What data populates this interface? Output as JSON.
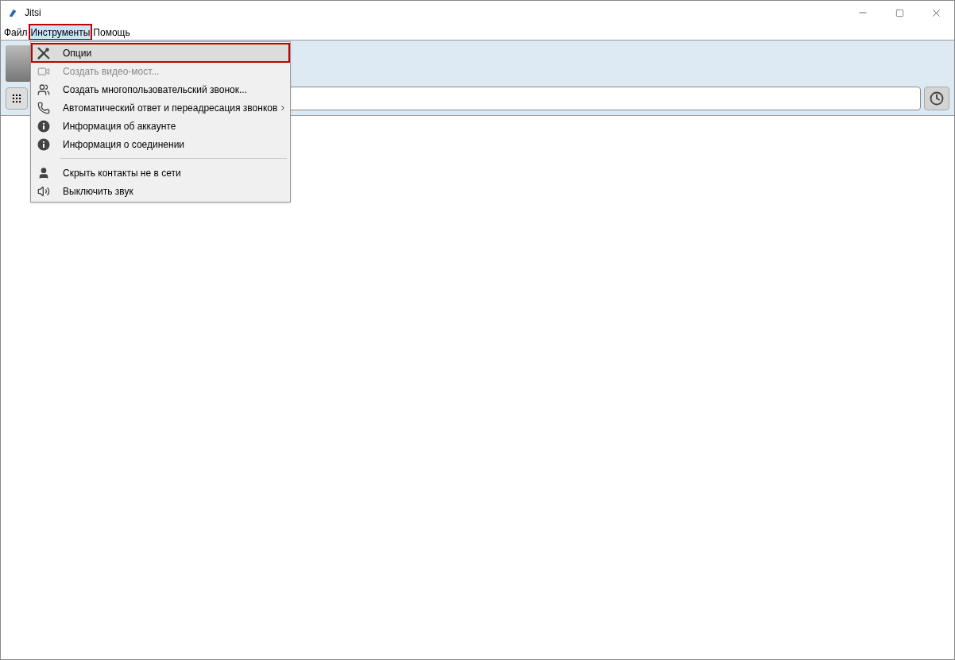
{
  "window": {
    "title": "Jitsi"
  },
  "menubar": [
    {
      "label": "Файл",
      "selected": false,
      "outlined": false
    },
    {
      "label": "Инструменты",
      "selected": true,
      "outlined": true
    },
    {
      "label": "Помощь",
      "selected": false,
      "outlined": false
    }
  ],
  "dropdown": [
    {
      "kind": "item",
      "label": "Опции",
      "disabled": false,
      "highlighted": true,
      "outlined": true,
      "submenu": false
    },
    {
      "kind": "item",
      "label": "Создать видео-мост...",
      "disabled": true,
      "highlighted": false,
      "outlined": false,
      "submenu": false
    },
    {
      "kind": "item",
      "label": "Создать многопользовательский звонок...",
      "disabled": false,
      "highlighted": false,
      "outlined": false,
      "submenu": false
    },
    {
      "kind": "item",
      "label": "Автоматический ответ и переадресация звонков",
      "disabled": false,
      "highlighted": false,
      "outlined": false,
      "submenu": true
    },
    {
      "kind": "item",
      "label": "Информация об аккаунте",
      "disabled": false,
      "highlighted": false,
      "outlined": false,
      "submenu": false
    },
    {
      "kind": "item",
      "label": "Информация о соединении",
      "disabled": false,
      "highlighted": false,
      "outlined": false,
      "submenu": false
    },
    {
      "kind": "separator"
    },
    {
      "kind": "item",
      "label": "Скрыть контакты не в сети",
      "disabled": false,
      "highlighted": false,
      "outlined": false,
      "submenu": false
    },
    {
      "kind": "item",
      "label": "Выключить звук",
      "disabled": false,
      "highlighted": false,
      "outlined": false,
      "submenu": false
    }
  ]
}
